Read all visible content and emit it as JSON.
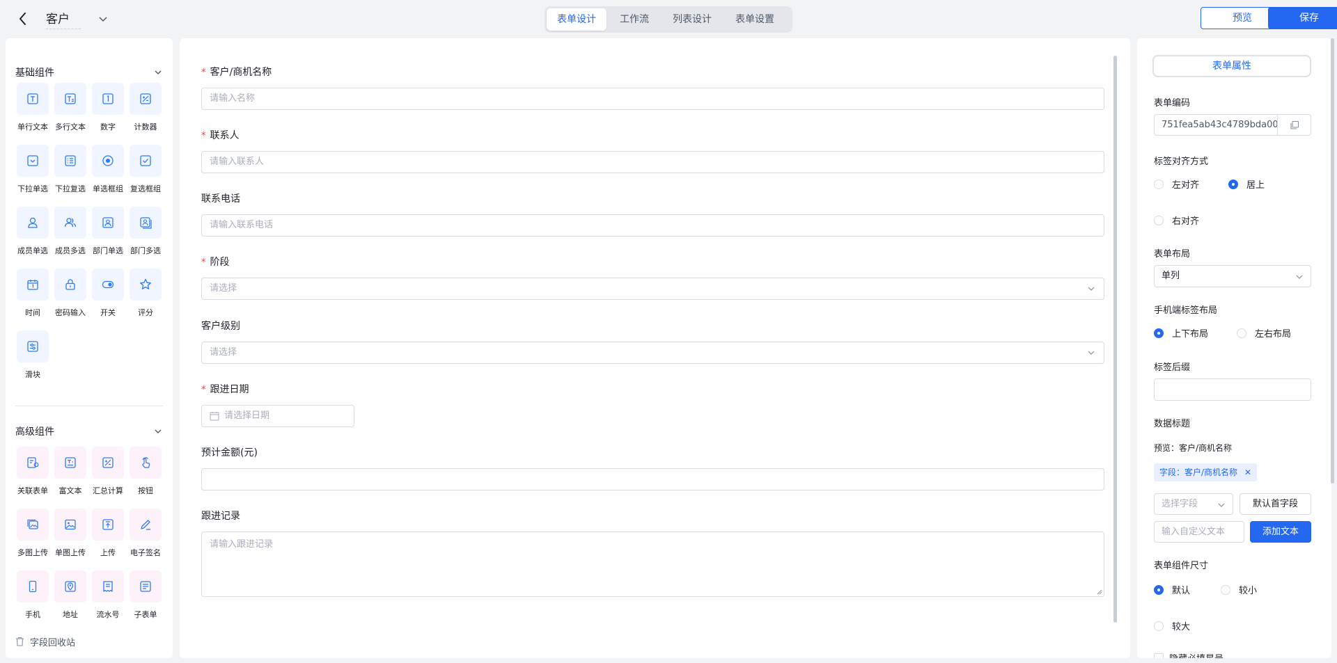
{
  "header": {
    "title": "客户",
    "tabs": [
      "表单设计",
      "工作流",
      "列表设计",
      "表单设置"
    ],
    "active_tab": "表单设计",
    "preview_label": "预览",
    "save_label": "保存"
  },
  "left": {
    "basic_title": "基础组件",
    "basic_items": [
      {
        "label": "单行文本",
        "icon": "single-line-text-icon"
      },
      {
        "label": "多行文本",
        "icon": "multi-line-text-icon"
      },
      {
        "label": "数字",
        "icon": "number-icon"
      },
      {
        "label": "计数器",
        "icon": "counter-icon"
      },
      {
        "label": "下拉单选",
        "icon": "dropdown-single-icon"
      },
      {
        "label": "下拉复选",
        "icon": "dropdown-multi-icon"
      },
      {
        "label": "单选框组",
        "icon": "radio-group-icon"
      },
      {
        "label": "复选框组",
        "icon": "checkbox-group-icon"
      },
      {
        "label": "成员单选",
        "icon": "member-single-icon"
      },
      {
        "label": "成员多选",
        "icon": "member-multi-icon"
      },
      {
        "label": "部门单选",
        "icon": "department-single-icon"
      },
      {
        "label": "部门多选",
        "icon": "department-multi-icon"
      },
      {
        "label": "时间",
        "icon": "calendar-icon"
      },
      {
        "label": "密码输入",
        "icon": "password-icon"
      },
      {
        "label": "开关",
        "icon": "switch-icon"
      },
      {
        "label": "评分",
        "icon": "star-icon"
      },
      {
        "label": "滑块",
        "icon": "slider-icon"
      }
    ],
    "advanced_title": "高级组件",
    "advanced_items": [
      {
        "label": "关联表单",
        "icon": "linked-form-icon"
      },
      {
        "label": "富文本",
        "icon": "rich-text-icon"
      },
      {
        "label": "汇总计算",
        "icon": "summary-calc-icon"
      },
      {
        "label": "按钮",
        "icon": "button-click-icon"
      },
      {
        "label": "多图上传",
        "icon": "multi-image-icon"
      },
      {
        "label": "单图上传",
        "icon": "single-image-icon"
      },
      {
        "label": "上传",
        "icon": "upload-icon"
      },
      {
        "label": "电子签名",
        "icon": "signature-icon"
      },
      {
        "label": "手机",
        "icon": "phone-icon"
      },
      {
        "label": "地址",
        "icon": "location-icon"
      },
      {
        "label": "流水号",
        "icon": "serial-number-icon"
      },
      {
        "label": "子表单",
        "icon": "sub-form-icon"
      }
    ],
    "recycle_label": "字段回收站"
  },
  "form": {
    "fields": [
      {
        "label": "客户/商机名称",
        "required": true,
        "type": "input",
        "placeholder": "请输入名称"
      },
      {
        "label": "联系人",
        "required": true,
        "type": "input",
        "placeholder": "请输入联系人"
      },
      {
        "label": "联系电话",
        "required": false,
        "type": "input",
        "placeholder": "请输入联系电话"
      },
      {
        "label": "阶段",
        "required": true,
        "type": "select",
        "placeholder": "请选择"
      },
      {
        "label": "客户级别",
        "required": false,
        "type": "select",
        "placeholder": "请选择"
      },
      {
        "label": "跟进日期",
        "required": true,
        "type": "date",
        "placeholder": "请选择日期"
      },
      {
        "label": "预计金额(元)",
        "required": false,
        "type": "input",
        "placeholder": ""
      },
      {
        "label": "跟进记录",
        "required": false,
        "type": "textarea",
        "placeholder": "请输入跟进记录"
      }
    ]
  },
  "right": {
    "props_tab": "表单属性",
    "code_label": "表单编码",
    "code_value": "751fea5ab43c4789bda00",
    "align_label": "标签对齐方式",
    "align_options": [
      "左对齐",
      "居上",
      "右对齐"
    ],
    "align_selected": "居上",
    "layout_label": "表单布局",
    "layout_value": "单列",
    "mobile_label": "手机端标签布局",
    "mobile_options": [
      "上下布局",
      "左右布局"
    ],
    "mobile_selected": "上下布局",
    "suffix_label": "标签后缀",
    "data_title_label": "数据标题",
    "preview_text": "预览：客户/商机名称",
    "chip_text": "字段：客户/商机名称",
    "select_field_placeholder": "选择字段",
    "default_first_label": "默认首字段",
    "custom_text_placeholder": "输入自定义文本",
    "add_text_label": "添加文本",
    "size_label": "表单组件尺寸",
    "size_options": [
      "默认",
      "较小",
      "较大"
    ],
    "size_selected": "默认",
    "hide_required_label": "隐藏必填星号"
  },
  "colors": {
    "accent": "#2468f2",
    "required": "#f53f3f",
    "basic_icon_bg": "#f0f5ff",
    "advanced_icon_bg": "#fdf2fa"
  }
}
